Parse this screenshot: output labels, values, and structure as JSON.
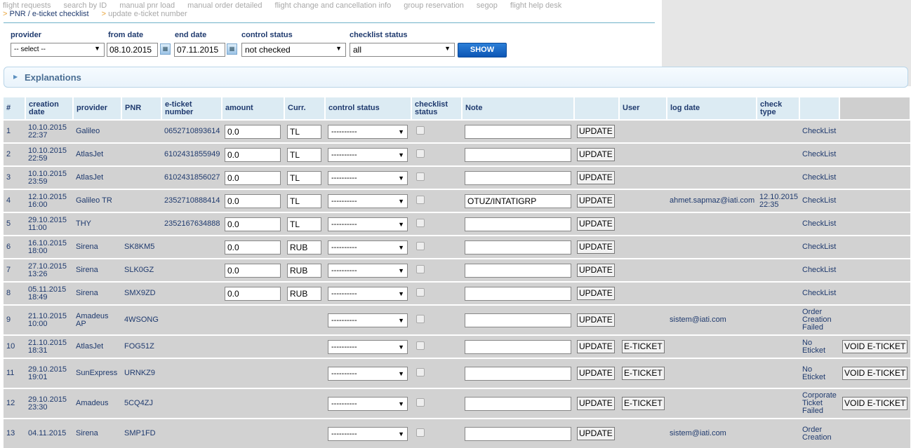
{
  "nav": {
    "row1": [
      "flight requests",
      "search by ID",
      "manual pnr load",
      "manual order detailed",
      "flight change and cancellation info",
      "group reservation",
      "segop",
      "flight help desk"
    ],
    "row2": [
      "PNR / e-ticket checklist",
      "update e-ticket number"
    ],
    "active": "PNR / e-ticket checklist"
  },
  "filters": {
    "provider_label": "provider",
    "provider_value": "-- select --",
    "from_label": "from date",
    "from_value": "08.10.2015",
    "end_label": "end date",
    "end_value": "07.11.2015",
    "control_label": "control status",
    "control_value": "not checked",
    "checklist_label": "checklist status",
    "checklist_value": "all",
    "show_label": "SHOW"
  },
  "explanations": {
    "title": "Explanations"
  },
  "table": {
    "headers": {
      "num": "#",
      "creation": "creation date",
      "provider": "provider",
      "pnr": "PNR",
      "eticket": "e-ticket number",
      "amount": "amount",
      "curr": "Curr.",
      "control": "control status",
      "checklist": "checklist status",
      "note": "Note",
      "user": "User",
      "logdate": "log date",
      "checktype": "check type"
    },
    "rows": [
      {
        "num": "1",
        "date": "10.10.2015",
        "time": "22:37",
        "provider": "Galileo",
        "pnr": "",
        "eticket": "0652710893614",
        "amount": "0.0",
        "curr": "TL",
        "control": "----------",
        "note": "",
        "update": "UPDATE",
        "eticket_btn": "",
        "user": "",
        "log_date": "",
        "log_time": "",
        "check_type": "CheckList",
        "void": ""
      },
      {
        "num": "2",
        "date": "10.10.2015",
        "time": "22:59",
        "provider": "AtlasJet",
        "pnr": "",
        "eticket": "6102431855949",
        "amount": "0.0",
        "curr": "TL",
        "control": "----------",
        "note": "",
        "update": "UPDATE",
        "eticket_btn": "",
        "user": "",
        "log_date": "",
        "log_time": "",
        "check_type": "CheckList",
        "void": ""
      },
      {
        "num": "3",
        "date": "10.10.2015",
        "time": "23:59",
        "provider": "AtlasJet",
        "pnr": "",
        "eticket": "6102431856027",
        "amount": "0.0",
        "curr": "TL",
        "control": "----------",
        "note": "",
        "update": "UPDATE",
        "eticket_btn": "",
        "user": "",
        "log_date": "",
        "log_time": "",
        "check_type": "CheckList",
        "void": ""
      },
      {
        "num": "4",
        "date": "12.10.2015",
        "time": "16:00",
        "provider": "Galileo TR",
        "pnr": "",
        "eticket": "2352710888414",
        "amount": "0.0",
        "curr": "TL",
        "control": "----------",
        "note": "OTUZ/INTATIGRP",
        "update": "UPDATE",
        "eticket_btn": "",
        "user": "ahmet.sapmaz@iati.com",
        "log_date": "12.10.2015",
        "log_time": "22:35",
        "check_type": "CheckList",
        "void": ""
      },
      {
        "num": "5",
        "date": "29.10.2015",
        "time": "11:00",
        "provider": "THY",
        "pnr": "",
        "eticket": "2352167634888",
        "amount": "0.0",
        "curr": "TL",
        "control": "----------",
        "note": "",
        "update": "UPDATE",
        "eticket_btn": "",
        "user": "",
        "log_date": "",
        "log_time": "",
        "check_type": "CheckList",
        "void": ""
      },
      {
        "num": "6",
        "date": "16.10.2015",
        "time": "18:00",
        "provider": "Sirena",
        "pnr": "SK8KM5",
        "eticket": "",
        "amount": "0.0",
        "curr": "RUB",
        "control": "----------",
        "note": "",
        "update": "UPDATE",
        "eticket_btn": "",
        "user": "",
        "log_date": "",
        "log_time": "",
        "check_type": "CheckList",
        "void": ""
      },
      {
        "num": "7",
        "date": "27.10.2015",
        "time": "13:26",
        "provider": "Sirena",
        "pnr": "SLK0GZ",
        "eticket": "",
        "amount": "0.0",
        "curr": "RUB",
        "control": "----------",
        "note": "",
        "update": "UPDATE",
        "eticket_btn": "",
        "user": "",
        "log_date": "",
        "log_time": "",
        "check_type": "CheckList",
        "void": ""
      },
      {
        "num": "8",
        "date": "05.11.2015",
        "time": "18:49",
        "provider": "Sirena",
        "pnr": "SMX9ZD",
        "eticket": "",
        "amount": "0.0",
        "curr": "RUB",
        "control": "----------",
        "note": "",
        "update": "UPDATE",
        "eticket_btn": "",
        "user": "",
        "log_date": "",
        "log_time": "",
        "check_type": "CheckList",
        "void": ""
      },
      {
        "num": "9",
        "date": "21.10.2015",
        "time": "10:00",
        "provider": "Amadeus AP",
        "pnr": "4WSONG",
        "eticket": "",
        "amount": "",
        "curr": "",
        "control": "----------",
        "note": "",
        "update": "UPDATE",
        "eticket_btn": "",
        "user": "sistem@iati.com",
        "log_date": "",
        "log_time": "",
        "check_type": "Order Creation Failed",
        "void": ""
      },
      {
        "num": "10",
        "date": "21.10.2015",
        "time": "18:31",
        "provider": "AtlasJet",
        "pnr": "FOG51Z",
        "eticket": "",
        "amount": "",
        "curr": "",
        "control": "----------",
        "note": "",
        "update": "UPDATE",
        "eticket_btn": "E-TICKET",
        "user": "",
        "log_date": "",
        "log_time": "",
        "check_type": "No Eticket",
        "void": "VOID E-TICKET"
      },
      {
        "num": "11",
        "date": "29.10.2015",
        "time": "19:01",
        "provider": "SunExpress",
        "pnr": "URNKZ9",
        "eticket": "",
        "amount": "",
        "curr": "",
        "control": "----------",
        "note": "",
        "update": "UPDATE",
        "eticket_btn": "E-TICKET",
        "user": "",
        "log_date": "",
        "log_time": "",
        "check_type": "No Eticket",
        "void": "VOID E-TICKET"
      },
      {
        "num": "12",
        "date": "29.10.2015",
        "time": "23:30",
        "provider": "Amadeus",
        "pnr": "5CQ4ZJ",
        "eticket": "",
        "amount": "",
        "curr": "",
        "control": "----------",
        "note": "",
        "update": "UPDATE",
        "eticket_btn": "E-TICKET",
        "user": "",
        "log_date": "",
        "log_time": "",
        "check_type": "Corporate Ticket Failed",
        "void": "VOID E-TICKET"
      },
      {
        "num": "13",
        "date": "04.11.2015",
        "time": "",
        "provider": "Sirena",
        "pnr": "SMP1FD",
        "eticket": "",
        "amount": "",
        "curr": "",
        "control": "----------",
        "note": "",
        "update": "UPDATE",
        "eticket_btn": "",
        "user": "sistem@iati.com",
        "log_date": "",
        "log_time": "",
        "check_type": "Order Creation",
        "void": ""
      }
    ]
  }
}
